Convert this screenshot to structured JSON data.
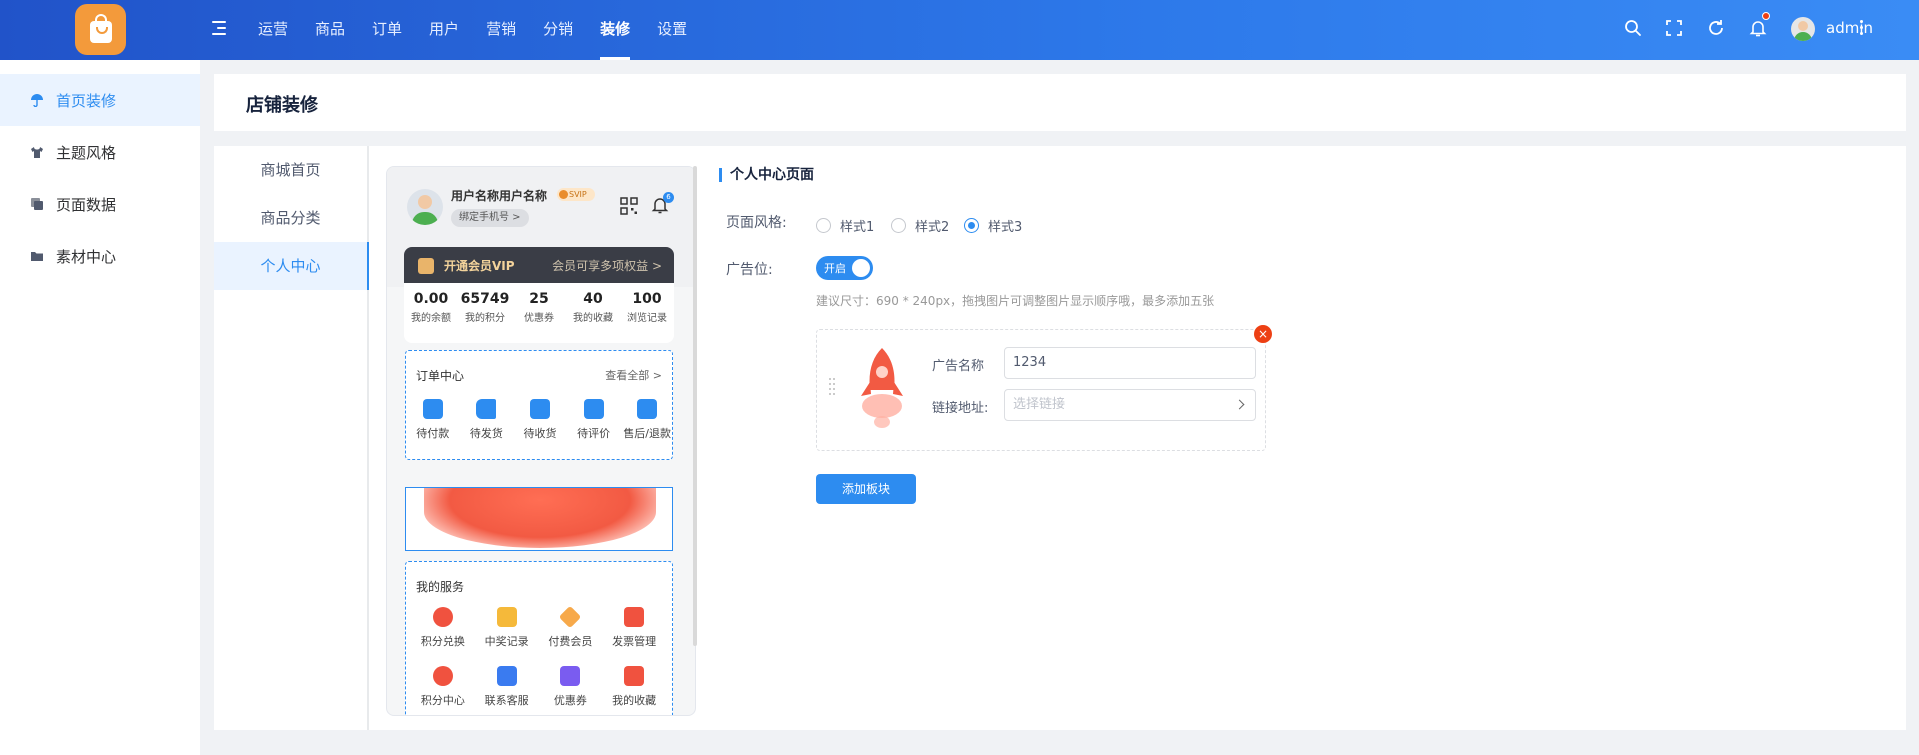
{
  "header": {
    "nav": [
      "运营",
      "商品",
      "订单",
      "用户",
      "营销",
      "分销",
      "装修",
      "设置"
    ],
    "active_nav": "装修",
    "username": "admin"
  },
  "sidebar": {
    "items": [
      {
        "label": "首页装修",
        "icon": "umbrella-icon",
        "active": true
      },
      {
        "label": "主题风格",
        "icon": "shirt-icon",
        "active": false
      },
      {
        "label": "页面数据",
        "icon": "copy-icon",
        "active": false
      },
      {
        "label": "素材中心",
        "icon": "folder-icon",
        "active": false
      }
    ]
  },
  "page": {
    "title": "店铺装修"
  },
  "submenu": {
    "items": [
      "商城首页",
      "商品分类",
      "个人中心"
    ],
    "active": "个人中心"
  },
  "preview": {
    "username": "用户名称用户名称",
    "svip": "SVIP",
    "bind_phone": "绑定手机号 >",
    "bell_badge": "6",
    "vip_title": "开通会员VIP",
    "vip_right": "会员可享多项权益 >",
    "stats": [
      {
        "num": "0.00",
        "label": "我的余额"
      },
      {
        "num": "65749",
        "label": "我的积分"
      },
      {
        "num": "25",
        "label": "优惠券"
      },
      {
        "num": "40",
        "label": "我的收藏"
      },
      {
        "num": "100",
        "label": "浏览记录"
      }
    ],
    "orders": {
      "title": "订单中心",
      "more": "查看全部 >",
      "items": [
        {
          "label": "待付款",
          "icon": "wallet-icon",
          "color": "#2d8cf0"
        },
        {
          "label": "待发货",
          "icon": "truck-icon",
          "color": "#2d8cf0"
        },
        {
          "label": "待收货",
          "icon": "box-icon",
          "color": "#2d8cf0"
        },
        {
          "label": "待评价",
          "icon": "comment-icon",
          "color": "#2d8cf0"
        },
        {
          "label": "售后/退款",
          "icon": "refund-icon",
          "color": "#2d8cf0"
        }
      ]
    },
    "services": {
      "title": "我的服务",
      "items": [
        {
          "label": "积分兑换",
          "icon": "gift-icon",
          "color": "#f0523f"
        },
        {
          "label": "中奖记录",
          "icon": "trophy-icon",
          "color": "#f5b93a"
        },
        {
          "label": "付费会员",
          "icon": "diamond-icon",
          "color": "#f7a94a"
        },
        {
          "label": "发票管理",
          "icon": "invoice-icon",
          "color": "#f0523f"
        },
        {
          "label": "积分中心",
          "icon": "coins-icon",
          "color": "#f0523f"
        },
        {
          "label": "联系客服",
          "icon": "service-icon",
          "color": "#3a7bf0"
        },
        {
          "label": "优惠券",
          "icon": "coupon-icon",
          "color": "#7a5cf0"
        },
        {
          "label": "我的收藏",
          "icon": "star-icon",
          "color": "#f0523f"
        }
      ]
    }
  },
  "config": {
    "section_title": "个人中心页面",
    "style_label": "页面风格:",
    "styles": [
      "样式1",
      "样式2",
      "样式3"
    ],
    "selected_style": "样式3",
    "ad_label": "广告位:",
    "switch_text": "开启",
    "hint": "建议尺寸：690 * 240px，拖拽图片可调整图片显示顺序哦，最多添加五张",
    "ad": {
      "name_label": "广告名称",
      "name_value": "1234",
      "link_label": "链接地址:",
      "link_placeholder": "选择链接"
    },
    "add_button": "添加板块"
  },
  "colors": {
    "primary": "#2d8cf0",
    "danger": "#ed4014",
    "header_start": "#2153c9",
    "header_end": "#3a8cf5"
  }
}
